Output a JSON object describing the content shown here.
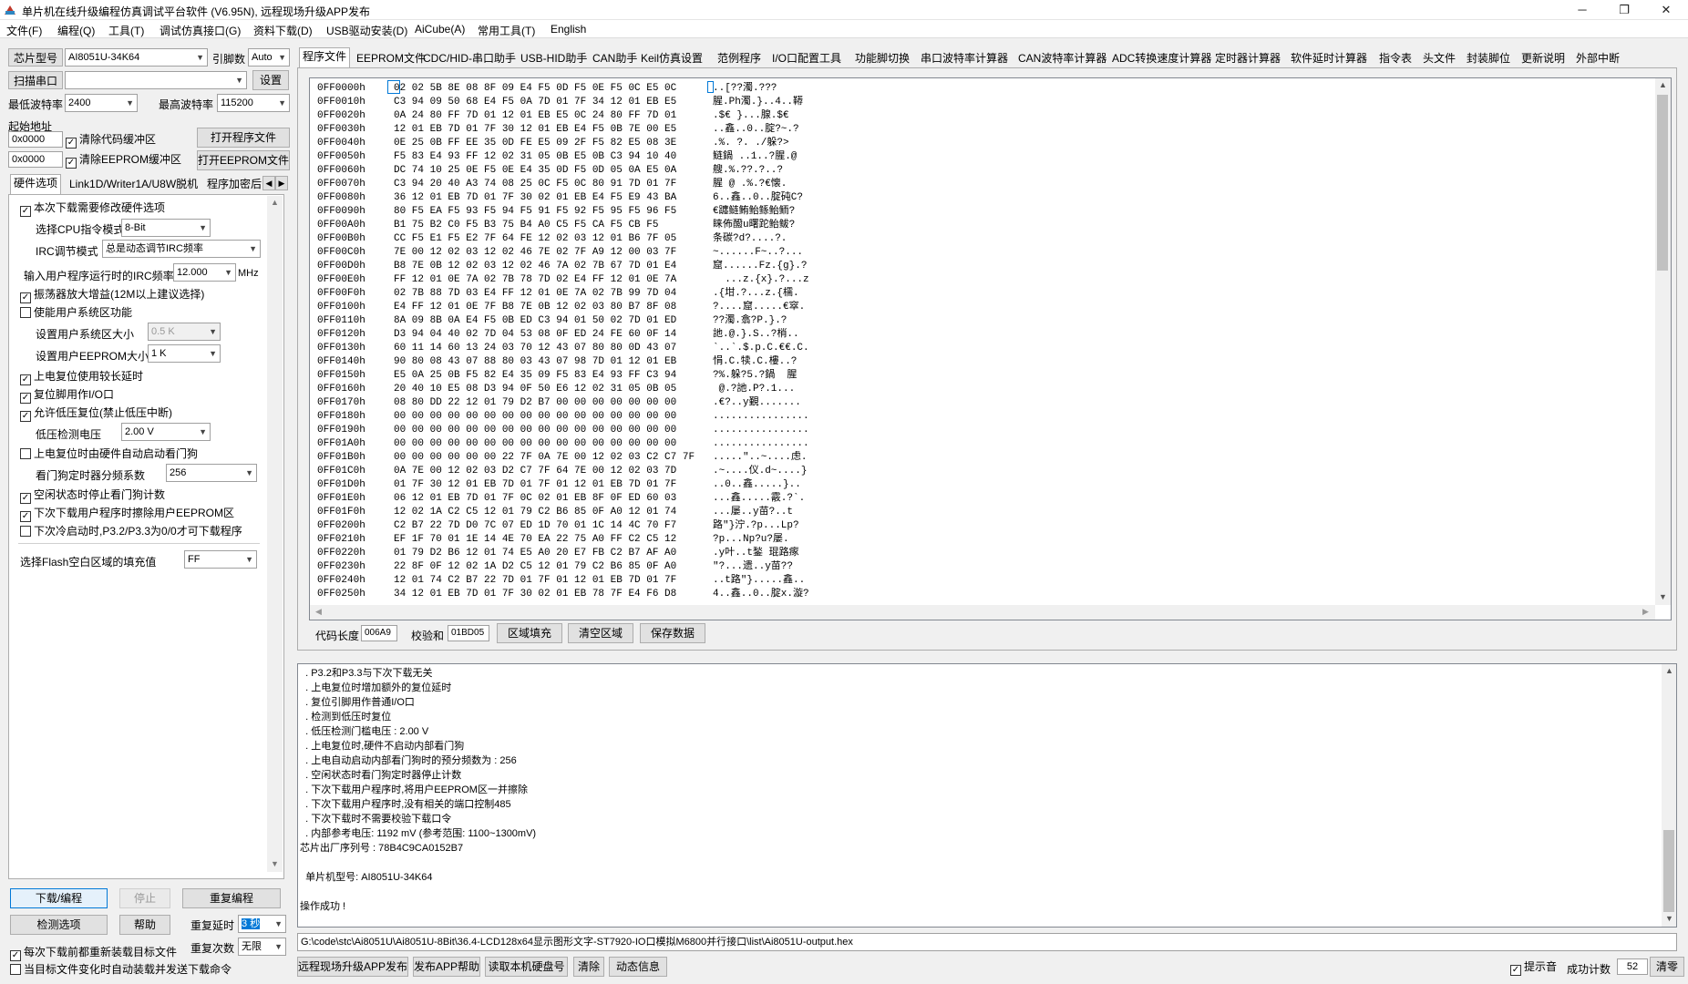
{
  "window": {
    "title": "单片机在线升级编程仿真调试平台软件 (V6.95N), 远程现场升级APP发布",
    "min": "─",
    "max": "❐",
    "close": "✕"
  },
  "menu": [
    "文件(F)",
    "编程(Q)",
    "工具(T)",
    "调试仿真接口(G)",
    "资料下载(D)",
    "USB驱动安装(D)",
    "AiCube(A)",
    "常用工具(T)",
    "English"
  ],
  "left": {
    "chip_label": "芯片型号",
    "chip_value": "AI8051U-34K64",
    "pin_label": "引脚数",
    "pin_value": "Auto",
    "scan_button": "扫描串口",
    "port_value": "",
    "settings_button": "设置",
    "min_baud_label": "最低波特率",
    "min_baud_value": "2400",
    "max_baud_label": "最高波特率",
    "max_baud_value": "115200",
    "start_addr_label": "起始地址",
    "code_addr": "0x0000",
    "clear_code_label": "清除代码缓冲区",
    "open_prog_button": "打开程序文件",
    "eeprom_addr": "0x0000",
    "clear_eeprom_label": "清除EEPROM缓冲区",
    "open_eeprom_button": "打开EEPROM文件",
    "tabs": [
      "硬件选项",
      "Link1D/Writer1A/U8W脱机",
      "程序加密后"
    ],
    "hw": {
      "modify_hw": "本次下载需要修改硬件选项",
      "cpu_mode_label": "选择CPU指令模式",
      "cpu_mode_value": "8-Bit",
      "irc_mode_label": "IRC调节模式",
      "irc_mode_value": "总是动态调节IRC频率",
      "irc_freq_label": "输入用户程序运行时的IRC频率",
      "irc_freq_value": "12.000",
      "irc_freq_unit": "MHz",
      "osc_gain": "振荡器放大增益(12M以上建议选择)",
      "user_sys_area": "使能用户系统区功能",
      "sys_size_label": "设置用户系统区大小",
      "sys_size_value": "0.5 K",
      "eeprom_size_label": "设置用户EEPROM大小",
      "eeprom_size_value": "1 K",
      "long_delay": "上电复位使用较长延时",
      "reset_io": "复位脚用作I/O口",
      "allow_lvr": "允许低压复位(禁止低压中断)",
      "lvd_label": "低压检测电压",
      "lvd_value": "2.00 V",
      "wdt_auto": "上电复位时由硬件自动启动看门狗",
      "wdt_div_label": "看门狗定时器分频系数",
      "wdt_div_value": "256",
      "idle_wdt": "空闲状态时停止看门狗计数",
      "erase_eeprom": "下次下载用户程序时擦除用户EEPROM区",
      "cold_start": "下次冷启动时,P3.2/P3.3为0/0才可下载程序",
      "fill_label": "选择Flash空白区域的填充值",
      "fill_value": "FF"
    },
    "download_button": "下载/编程",
    "stop_button": "停止",
    "reprogram_button": "重复编程",
    "check_button": "检测选项",
    "help_button": "帮助",
    "repeat_delay_label": "重复延时",
    "repeat_delay_value": "3 秒",
    "repeat_count_label": "重复次数",
    "repeat_count_value": "无限",
    "reload_each": "每次下载前都重新装载目标文件",
    "auto_reload": "当目标文件变化时自动装载并发送下载命令"
  },
  "main_tabs": [
    "程序文件",
    "EEPROM文件",
    "CDC/HID-串口助手",
    "USB-HID助手",
    "CAN助手",
    "Keil仿真设置",
    "范例程序",
    "I/O口配置工具",
    "功能脚切换",
    "串口波特率计算器",
    "CAN波特率计算器",
    "ADC转换速度计算器",
    "定时器计算器",
    "软件延时计算器",
    "指令表",
    "头文件",
    "封装脚位",
    "更新说明",
    "外部中断"
  ],
  "hex_rows": [
    {
      "a": "0FF0000h",
      "b": "02 02 5B 8E 08 8F 09 E4 F5 0D F5 0E F5 0C E5 0C",
      "s": "..[??濁.???"
    },
    {
      "a": "0FF0010h",
      "b": "C3 94 09 50 68 E4 F5 0A 7D 01 7F 34 12 01 EB E5",
      "s": "腥.Ph濁.}..4..鞯"
    },
    {
      "a": "0FF0020h",
      "b": "0A 24 80 FF 7D 01 12 01 EB E5 0C 24 80 FF 7D 01",
      "s": ".$€ }...腺.$€"
    },
    {
      "a": "0FF0030h",
      "b": "12 01 EB 7D 01 7F 30 12 01 EB E4 F5 0B 7E 00 E5",
      "s": "..鑫..0..腚?~.?"
    },
    {
      "a": "0FF0040h",
      "b": "0E 25 0B FF EE 35 0D FE E5 09 2F F5 82 E5 08 3E",
      "s": ".%. ?. ./躲?>"
    },
    {
      "a": "0FF0050h",
      "b": "F5 83 E4 93 FF 12 02 31 05 0B E5 0B C3 94 10 40",
      "s": "鲢鍋 ..1..?腥.@"
    },
    {
      "a": "0FF0060h",
      "b": "DC 74 10 25 0E F5 0E E4 35 0D F5 0D 05 0A E5 0A",
      "s": "艘.%.??.?..?"
    },
    {
      "a": "0FF0070h",
      "b": "C3 94 20 40 A3 74 08 25 0C F5 0C 80 91 7D 01 7F",
      "s": "腥 @ .%.?€懐."
    },
    {
      "a": "0FF0080h",
      "b": "36 12 01 EB 7D 01 7F 30 02 01 EB E4 F5 E9 43 BA",
      "s": "6..鑫..0..腚砘C?"
    },
    {
      "a": "0FF0090h",
      "b": "80 F5 EA F5 93 F5 94 F5 91 F5 92 F5 95 F5 96 F5",
      "s": "€躔鲢鲔鲐鲧鲐鲕?"
    },
    {
      "a": "0FF00A0h",
      "b": "B1 75 B2 C0 F5 B3 75 B4 A0 C5 F5 CA F5 CB F5",
      "s": "睐佈醱u曙跎鲐鲅?"
    },
    {
      "a": "0FF00B0h",
      "b": "CC F5 E1 F5 E2 7F 64 FE 12 02 03 12 01 B6 7F 05",
      "s": "条碳?d?....?."
    },
    {
      "a": "0FF00C0h",
      "b": "7E 00 12 02 03 12 02 46 7E 02 7F A9 12 00 03 7F",
      "s": "~......F~..?..."
    },
    {
      "a": "0FF00D0h",
      "b": "B8 7E 0B 12 02 03 12 02 46 7A 02 7B 67 7D 01 E4",
      "s": "窟......Fz.{g}.?"
    },
    {
      "a": "0FF00E0h",
      "b": "FF 12 01 0E 7A 02 7B 78 7D 02 E4 FF 12 01 0E 7A",
      "s": "  ...z.{x}.?...z"
    },
    {
      "a": "0FF00F0h",
      "b": "02 7B 88 7D 03 E4 FF 12 01 0E 7A 02 7B 99 7D 04",
      "s": ".{坩.?...z.{檽."
    },
    {
      "a": "0FF0100h",
      "b": "E4 FF 12 01 0E 7F B8 7E 0B 12 02 03 80 B7 8F 08",
      "s": "?....窟.....€窣."
    },
    {
      "a": "0FF0110h",
      "b": "8A 09 8B 0A E4 F5 0B ED C3 94 01 50 02 7D 01 ED",
      "s": "??濁.翕?P.}.?"
    },
    {
      "a": "0FF0120h",
      "b": "D3 94 04 40 02 7D 04 53 08 0F ED 24 FE 60 0F 14",
      "s": "訑.@.}.S..?梢.."
    },
    {
      "a": "0FF0130h",
      "b": "60 11 14 60 13 24 03 70 12 43 07 80 80 0D 43 07",
      "s": "`..`.$.p.C.€€.C."
    },
    {
      "a": "0FF0140h",
      "b": "90 80 08 43 07 88 80 03 43 07 98 7D 01 12 01 EB",
      "s": "悁.C.犊.C.樓..?"
    },
    {
      "a": "0FF0150h",
      "b": "E5 0A 25 0B F5 82 E4 35 09 F5 83 E4 93 FF C3 94",
      "s": "?%.躲?5.?鍋  腥"
    },
    {
      "a": "0FF0160h",
      "b": "20 40 10 E5 08 D3 94 0F 50 E6 12 02 31 05 0B 05",
      "s": " @.?訑.P?.1..."
    },
    {
      "a": "0FF0170h",
      "b": "08 80 DD 22 12 01 79 D2 B7 00 00 00 00 00 00 00",
      "s": ".€?..y覲......."
    },
    {
      "a": "0FF0180h",
      "b": "00 00 00 00 00 00 00 00 00 00 00 00 00 00 00 00",
      "s": "................"
    },
    {
      "a": "0FF0190h",
      "b": "00 00 00 00 00 00 00 00 00 00 00 00 00 00 00 00",
      "s": "................"
    },
    {
      "a": "0FF01A0h",
      "b": "00 00 00 00 00 00 00 00 00 00 00 00 00 00 00 00",
      "s": "................"
    },
    {
      "a": "0FF01B0h",
      "b": "00 00 00 00 00 00 22 7F 0A 7E 00 12 02 03 C2 C7 7F",
      "s": ".....\"..~....虑."
    },
    {
      "a": "0FF01C0h",
      "b": "0A 7E 00 12 02 03 D2 C7 7F 64 7E 00 12 02 03 7D",
      "s": ".~....仪.d~....}"
    },
    {
      "a": "0FF01D0h",
      "b": "01 7F 30 12 01 EB 7D 01 7F 01 12 01 EB 7D 01 7F",
      "s": "..0..鑫.....}.."
    },
    {
      "a": "0FF01E0h",
      "b": "06 12 01 EB 7D 01 7F 0C 02 01 EB 8F 0F ED 60 03",
      "s": "...鑫.....霰.?`."
    },
    {
      "a": "0FF01F0h",
      "b": "12 02 1A C2 C5 12 01 79 C2 B6 85 0F A0 12 01 74",
      "s": "...屡..y苗?..t"
    },
    {
      "a": "0FF0200h",
      "b": "C2 B7 22 7D D0 7C 07 ED 1D 70 01 1C 14 4C 70 F7",
      "s": "路\"}泞.?p...Lp?"
    },
    {
      "a": "0FF0210h",
      "b": "EF 1F 70 01 1E 14 4E 70 EA 22 75 A0 FF C2 C5 12",
      "s": "?p...Np?u?屡."
    },
    {
      "a": "0FF0220h",
      "b": "01 79 D2 B6 12 01 74 E5 A0 20 E7 FB C2 B7 AF A0",
      "s": ".y叶..t鍫 琨路瘃"
    },
    {
      "a": "0FF0230h",
      "b": "22 8F 0F 12 02 1A D2 C5 12 01 79 C2 B6 85 0F A0",
      "s": "\"?...遗..y苗??"
    },
    {
      "a": "0FF0240h",
      "b": "12 01 74 C2 B7 22 7D 01 7F 01 12 01 EB 7D 01 7F",
      "s": "..t路\"}.....鑫.."
    },
    {
      "a": "0FF0250h",
      "b": "34 12 01 EB 7D 01 7F 30 02 01 EB 78 7F E4 F6 D8",
      "s": "4..鑫..0..腚x.漩?"
    }
  ],
  "hex_footer": {
    "code_len_label": "代码长度",
    "code_len_value": "006A9",
    "checksum_label": "校验和",
    "checksum_value": "01BD05",
    "fill_button": "区域填充",
    "clear_button": "清空区域",
    "save_button": "保存数据"
  },
  "log_lines": [
    "  . P3.2和P3.3与下次下载无关",
    "  . 上电复位时增加额外的复位延时",
    "  . 复位引脚用作普通I/O口",
    "  . 检测到低压时复位",
    "  . 低压检测门槛电压 : 2.00 V",
    "  . 上电复位时,硬件不启动内部看门狗",
    "  . 上电自动启动内部看门狗时的预分频数为 : 256",
    "  . 空闲状态时看门狗定时器停止计数",
    "  . 下次下载用户程序时,将用户EEPROM区一并擦除",
    "  . 下次下载用户程序时,没有相关的端口控制485",
    "  . 下次下载时不需要校验下载口令",
    "  . 内部参考电压: 1192 mV (参考范围: 1100~1300mV)",
    "芯片出厂序列号 : 78B4C9CA0152B7",
    "",
    "  单片机型号: AI8051U-34K64",
    "",
    "操作成功 !"
  ],
  "file_path": "G:\\code\\stc\\Ai8051U\\Ai8051U-8Bit\\36.4-LCD128x64显示图形文字-ST7920-IO口模拟M6800并行接口\\list\\Ai8051U-output.hex",
  "bottom": {
    "remote_publish": "远程现场升级APP发布",
    "publish_help": "发布APP帮助",
    "read_hdd": "读取本机硬盘号",
    "clear": "清除",
    "dyn_info": "动态信息",
    "beep_label": "提示音",
    "success_label": "成功计数",
    "success_value": "52",
    "clear_zero": "清零"
  }
}
